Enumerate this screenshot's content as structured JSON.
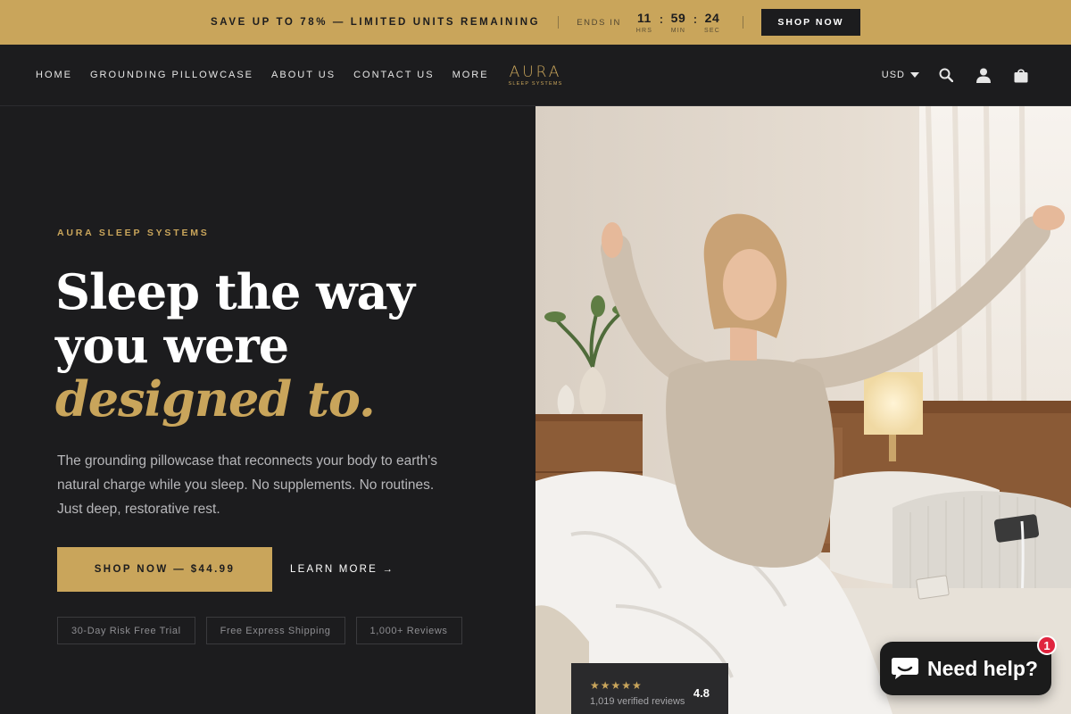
{
  "announcement": {
    "promo": "SAVE UP TO 78% — LIMITED UNITS REMAINING",
    "ends_label": "ENDS IN",
    "countdown": [
      {
        "value": "11",
        "label": "HRS"
      },
      {
        "value": "59",
        "label": "MIN"
      },
      {
        "value": "24",
        "label": "SEC"
      }
    ],
    "shop_now": "SHOP NOW"
  },
  "nav": {
    "links": [
      "HOME",
      "GROUNDING PILLOWCASE",
      "ABOUT US",
      "CONTACT US",
      "MORE"
    ],
    "logo_main": "AURA",
    "logo_sub": "SLEEP SYSTEMS",
    "currency": "USD",
    "icons": [
      "search-icon",
      "account-icon",
      "cart-icon"
    ]
  },
  "hero": {
    "eyebrow": "AURA SLEEP SYSTEMS",
    "headline_line1": "Sleep the way",
    "headline_line2": "you were",
    "headline_accent": "designed to.",
    "subcopy": "The grounding pillowcase that reconnects your body to earth's natural charge while you sleep. No supplements. No routines. Just deep, restorative rest.",
    "cta_primary": "SHOP NOW — $44.99",
    "cta_secondary": "LEARN MORE →",
    "badges": [
      "30-Day Risk Free Trial",
      "Free Express Shipping",
      "1,000+ Reviews"
    ]
  },
  "rating": {
    "stars": "★★★★★",
    "count": "1,019 verified reviews",
    "score": "4.8"
  },
  "chat": {
    "label": "Need help?",
    "badge_count": "1"
  },
  "colors": {
    "gold": "#c9a55b",
    "dark": "#1c1c1e",
    "chat_badge": "#e0243e"
  }
}
